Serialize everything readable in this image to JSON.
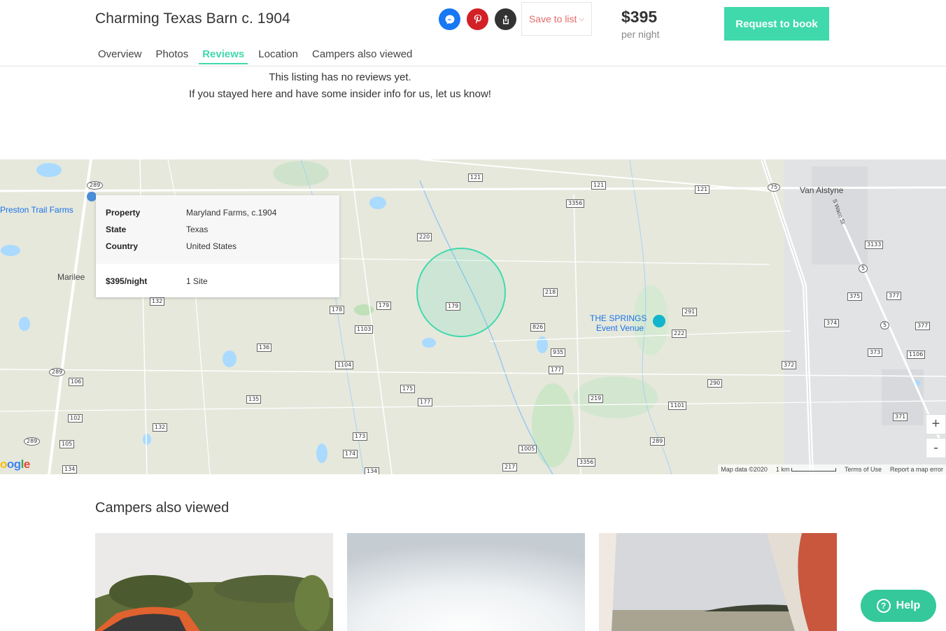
{
  "header": {
    "title": "Charming Texas Barn c. 1904",
    "save_label": "Save to list",
    "price": "$395",
    "price_unit": "per night",
    "book_label": "Request to book"
  },
  "tabs": [
    {
      "label": "Overview"
    },
    {
      "label": "Photos"
    },
    {
      "label": "Reviews",
      "active": true
    },
    {
      "label": "Location"
    },
    {
      "label": "Campers also viewed"
    }
  ],
  "reviews": {
    "line1": "This listing has no reviews yet.",
    "line2": "If you stayed here and have some insider info for us, let us know!"
  },
  "map": {
    "popup": {
      "property_label": "Property",
      "property_value": "Maryland Farms, c.1904",
      "state_label": "State",
      "state_value": "Texas",
      "country_label": "Country",
      "country_value": "United States",
      "price_label": "$395/night",
      "sites_value": "1 Site"
    },
    "places": {
      "preston": "Preston Trail Farms",
      "marilee": "Marilee",
      "van_alstyne": "Van Alstyne",
      "springs_1": "THE SPRINGS",
      "springs_2": "Event Venue",
      "waco": "S Waco St"
    },
    "routes": {
      "r121a": "121",
      "r121b": "121",
      "r121c": "121",
      "r3356a": "3356",
      "r220": "220",
      "r179a": "179",
      "r179b": "179",
      "r178": "178",
      "r132a": "132",
      "r1103": "1103",
      "r136": "136",
      "r1104": "1104",
      "r218": "218",
      "r826": "826",
      "r935": "935",
      "r177a": "177",
      "r177b": "177",
      "r175": "175",
      "r135": "135",
      "r106": "106",
      "r102": "102",
      "r105": "105",
      "r132b": "132",
      "r173": "173",
      "r174": "174",
      "r134a": "134",
      "r134b": "134",
      "r1005": "1005",
      "r217": "217",
      "r3356b": "3356",
      "r219": "219",
      "r289a": "289",
      "r289b": "289",
      "r289c": "289",
      "r289d": "289",
      "r291": "291",
      "r222": "222",
      "r290": "290",
      "r1101": "1101",
      "r372": "372",
      "r373": "373",
      "r374": "374",
      "r375": "375",
      "r377a": "377",
      "r377b": "377",
      "r1106": "1106",
      "r371": "371",
      "r3133": "3133",
      "r5a": "5",
      "r5b": "5",
      "r75": "75"
    },
    "zoom_in": "+",
    "zoom_out": "-",
    "google": "oogle",
    "footer": {
      "map_data": "Map data ©2020",
      "scale": "1 km",
      "terms": "Terms of Use",
      "report": "Report a map error"
    }
  },
  "also_viewed": {
    "title": "Campers also viewed"
  },
  "help": {
    "label": "Help",
    "icon": "?"
  },
  "colors": {
    "accent": "#40d9ac",
    "save_text": "#e46b6b",
    "messenger": "#1877f2",
    "pinterest": "#d32027"
  }
}
